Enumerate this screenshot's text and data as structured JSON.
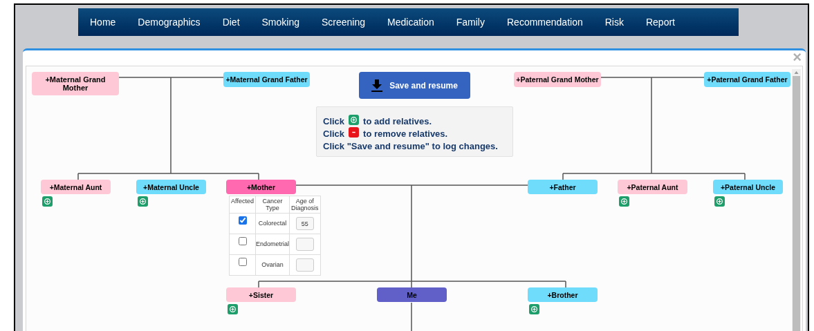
{
  "nav": [
    {
      "label": "Home"
    },
    {
      "label": "Demographics"
    },
    {
      "label": "Diet"
    },
    {
      "label": "Smoking"
    },
    {
      "label": "Screening"
    },
    {
      "label": "Medication"
    },
    {
      "label": "Family"
    },
    {
      "label": "Recommendation"
    },
    {
      "label": "Risk"
    },
    {
      "label": "Report"
    }
  ],
  "modal": {
    "close": "×",
    "save_button": "Save and resume",
    "instructions": [
      {
        "kind": "add",
        "before": "Click",
        "after": "to add relatives."
      },
      {
        "kind": "remove",
        "before": "Click",
        "after": "to remove relatives."
      },
      {
        "kind": "text",
        "before": "Click \"Save and resume\" to log changes."
      }
    ],
    "nodes": [
      {
        "label": "+Maternal Grand Mother",
        "color": "#ffc8d6",
        "can_add": false
      },
      {
        "label": "+Maternal Grand Father",
        "color": "#6fdcfb",
        "can_add": false
      },
      {
        "label": "+Paternal Grand Mother",
        "color": "#ffc8d6",
        "can_add": false
      },
      {
        "label": "+Paternal Grand Father",
        "color": "#6fdcfb",
        "can_add": false
      },
      {
        "label": "+Maternal Aunt",
        "color": "#ffc8d6",
        "can_add": true
      },
      {
        "label": "+Maternal Uncle",
        "color": "#6fdcfb",
        "can_add": true
      },
      {
        "label": "+Mother",
        "color": "#ff69b0",
        "can_add": false
      },
      {
        "label": "+Father",
        "color": "#6fdcfb",
        "can_add": false
      },
      {
        "label": "+Paternal Aunt",
        "color": "#ffc8d6",
        "can_add": true
      },
      {
        "label": "+Paternal Uncle",
        "color": "#6fdcfb",
        "can_add": true
      },
      {
        "label": "+Sister",
        "color": "#ffc8d6",
        "can_add": true
      },
      {
        "label": "Me",
        "color": "#6060c8",
        "can_add": false
      },
      {
        "label": "+Brother",
        "color": "#6fdcfb",
        "can_add": true
      }
    ],
    "cancer_table": {
      "columns": [
        "Affected",
        "Cancer Type",
        "Age of Diagnosis"
      ],
      "rows": [
        {
          "checked": true,
          "cancer_type": "Colorectal",
          "age": "55"
        },
        {
          "checked": false,
          "cancer_type": "Endometrial"
        },
        {
          "checked": false,
          "cancer_type": "Ovarian"
        }
      ]
    }
  }
}
